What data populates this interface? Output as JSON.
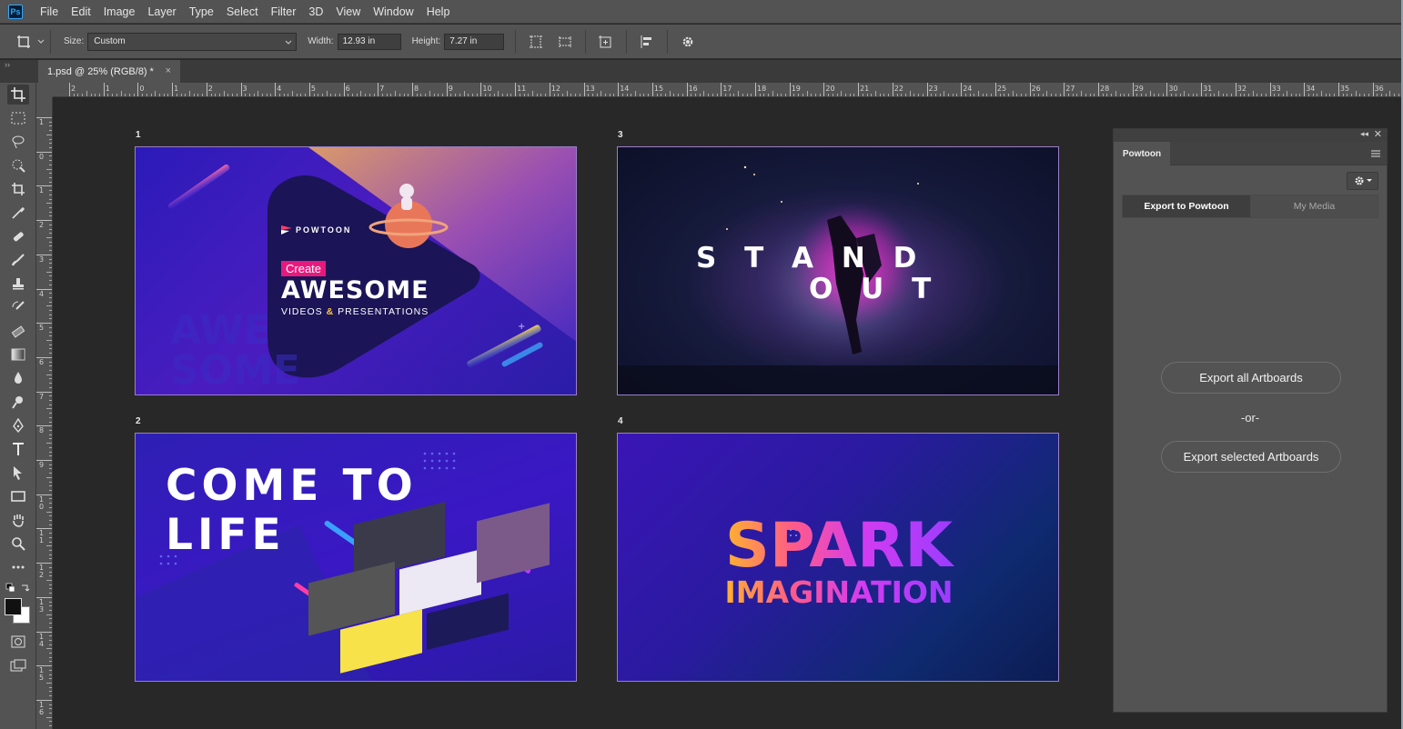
{
  "menubar": {
    "app_icon": "Ps",
    "items": [
      "File",
      "Edit",
      "Image",
      "Layer",
      "Type",
      "Select",
      "Filter",
      "3D",
      "View",
      "Window",
      "Help"
    ]
  },
  "options": {
    "size_label": "Size:",
    "size_value": "Custom",
    "width_label": "Width:",
    "width_value": "12.93 in",
    "height_label": "Height:",
    "height_value": "7.27 in"
  },
  "document": {
    "tab_title": "1.psd @ 25% (RGB/8) *",
    "close_glyph": "×"
  },
  "rulers": {
    "horizontal_ticks": [
      "2",
      "1",
      "0",
      "1",
      "2",
      "3",
      "4",
      "5",
      "6",
      "7",
      "8",
      "9",
      "10",
      "11",
      "12",
      "13",
      "14",
      "15",
      "16",
      "17",
      "18",
      "19",
      "20",
      "21",
      "22",
      "23",
      "24",
      "25",
      "26",
      "27",
      "28",
      "29",
      "30",
      "31",
      "32",
      "33",
      "34",
      "35",
      "36"
    ],
    "vertical_ticks": [
      "1",
      "0",
      "1",
      "2",
      "3",
      "4",
      "5",
      "6",
      "7",
      "8",
      "9",
      "10",
      "11",
      "12",
      "13",
      "14",
      "15",
      "16"
    ]
  },
  "artboards": [
    {
      "label": "1",
      "brand": "POWTOON",
      "badge": "Create",
      "headline": "AWESOME",
      "subline_a": "VIDEOS",
      "amp": "&",
      "subline_b": "PRESENTATIONS",
      "bg_word": "AWE SOME"
    },
    {
      "label": "3",
      "line1": "S T A N D",
      "line2": "O U T"
    },
    {
      "label": "2",
      "line1": "COME TO",
      "line2": "LIFE"
    },
    {
      "label": "4",
      "line1": "SPARK",
      "line2": "IMAGINATION"
    }
  ],
  "panel": {
    "title": "Powtoon",
    "tab_export": "Export to Powtoon",
    "tab_media": "My Media",
    "export_all": "Export all Artboards",
    "or": "-or-",
    "export_selected": "Export selected Artboards"
  },
  "colors": {
    "ui_dark": "#282828",
    "ui_panel": "#535353",
    "accent_pink": "#e8197d",
    "artboard_purple": "#3a14b8"
  }
}
